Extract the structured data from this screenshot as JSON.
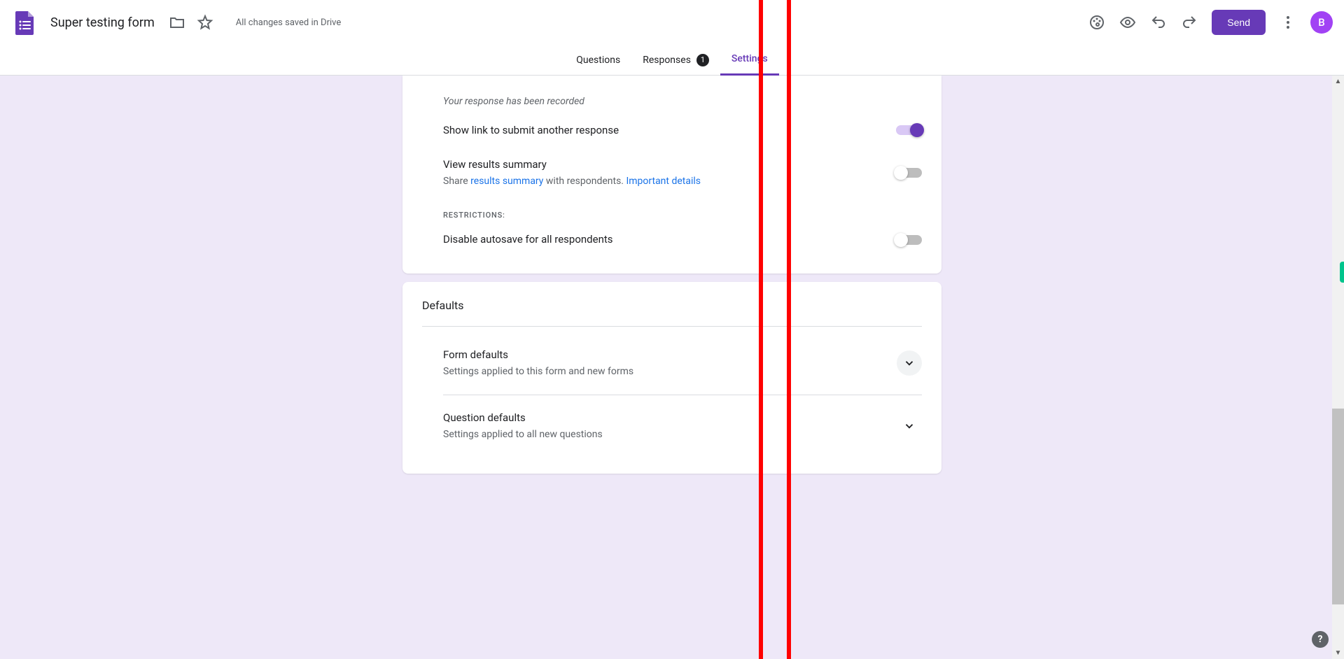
{
  "header": {
    "title": "Super testing form",
    "saved": "All changes saved in Drive",
    "send": "Send",
    "avatar": "B"
  },
  "tabs": {
    "questions": "Questions",
    "responses": "Responses",
    "responses_badge": "1",
    "settings": "Settings"
  },
  "presentation_card": {
    "confirm_sub": "Your response has been recorded",
    "r_link": "Show link to submit another response",
    "r_summary": "View results summary",
    "r_summary_sub_pre": "Share ",
    "r_summary_link1": "results summary",
    "r_summary_sub_mid": " with respondents. ",
    "r_summary_link2": "Important details",
    "restrictions": "RESTRICTIONS:",
    "r_autosave": "Disable autosave for all respondents"
  },
  "defaults_card": {
    "title": "Defaults",
    "form_t": "Form defaults",
    "form_s": "Settings applied to this form and new forms",
    "q_t": "Question defaults",
    "q_s": "Settings applied to all new questions"
  }
}
